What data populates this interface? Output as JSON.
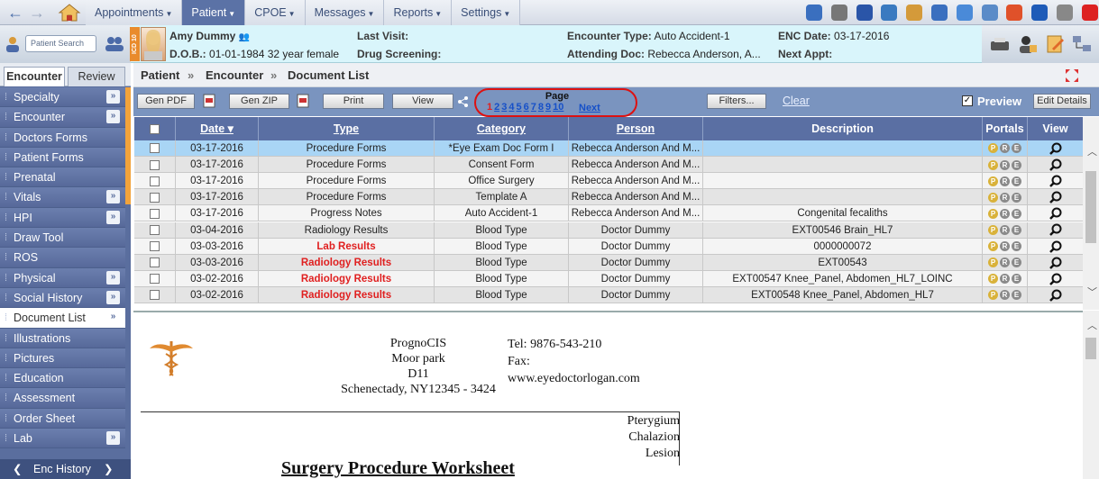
{
  "nav": {
    "back": "←",
    "forward": "→"
  },
  "menus": [
    {
      "label": "Appointments",
      "active": false
    },
    {
      "label": "Patient",
      "active": true
    },
    {
      "label": "CPOE",
      "active": false
    },
    {
      "label": "Messages",
      "active": false
    },
    {
      "label": "Reports",
      "active": false
    },
    {
      "label": "Settings",
      "active": false
    }
  ],
  "top_icons": [
    "calendar-icon",
    "gauge-icon",
    "bill-icon",
    "schedule-icon",
    "doctor-icon",
    "stethoscope-icon",
    "mail-icon",
    "documents-icon",
    "lifebuoy-icon",
    "info-icon",
    "checkbox-icon",
    "power-icon"
  ],
  "search": {
    "placeholder": "Patient Search"
  },
  "icd": "ICD 10",
  "patient": {
    "name": "Amy Dummy",
    "dob_label": "D.O.B.:",
    "dob_value": "01-01-1984 32 year female",
    "last_visit_label": "Last Visit:",
    "last_visit_value": "",
    "drug_label": "Drug Screening:",
    "drug_value": "",
    "enc_type_label": "Encounter Type:",
    "enc_type_value": "Auto Accident-1",
    "att_doc_label": "Attending Doc:",
    "att_doc_value": "Rebecca Anderson, A...",
    "enc_date_label": "ENC Date:",
    "enc_date_value": "03-17-2016",
    "next_appt_label": "Next Appt:",
    "next_appt_value": ""
  },
  "tabs": {
    "encounter": "Encounter",
    "review": "Review"
  },
  "sidebar": [
    {
      "label": "Specialty",
      "chev": true
    },
    {
      "label": "Encounter",
      "chev": true
    },
    {
      "label": "Doctors Forms",
      "chev": false
    },
    {
      "label": "Patient Forms",
      "chev": false
    },
    {
      "label": "Prenatal",
      "chev": false
    },
    {
      "label": "Vitals",
      "chev": true
    },
    {
      "label": "HPI",
      "chev": true
    },
    {
      "label": "Draw Tool",
      "chev": false
    },
    {
      "label": "ROS",
      "chev": false
    },
    {
      "label": "Physical",
      "chev": true
    },
    {
      "label": "Social History",
      "chev": true
    },
    {
      "label": "Document List",
      "chev": true,
      "active": true
    },
    {
      "label": "Illustrations",
      "chev": false
    },
    {
      "label": "Pictures",
      "chev": false
    },
    {
      "label": "Education",
      "chev": false
    },
    {
      "label": "Assessment",
      "chev": false
    },
    {
      "label": "Order Sheet",
      "chev": false
    },
    {
      "label": "Lab",
      "chev": true
    }
  ],
  "enc_history": "Enc History",
  "breadcrumb": {
    "patient": "Patient",
    "encounter": "Encounter",
    "current": "Document List",
    "sep": "»"
  },
  "toolbar": {
    "gen_pdf": "Gen PDF",
    "gen_zip": "Gen ZIP",
    "print": "Print",
    "view": "View",
    "page_label": "Page",
    "pages": [
      "1",
      "2",
      "3",
      "4",
      "5",
      "6",
      "7",
      "8",
      "9",
      "10"
    ],
    "current_page": "1",
    "next": "Next",
    "filters": "Filters...",
    "clear": "Clear",
    "preview": "Preview",
    "edit_details": "Edit Details"
  },
  "table": {
    "headers": {
      "date": "Date ▾",
      "type": "Type",
      "category": "Category",
      "person": "Person",
      "description": "Description",
      "portals": "Portals",
      "view": "View"
    },
    "rows": [
      {
        "date": "03-17-2016",
        "type": "Procedure Forms",
        "type_red": false,
        "category": "*Eye Exam Doc Form I",
        "person": "Rebecca Anderson And M...",
        "description": "",
        "selected": true
      },
      {
        "date": "03-17-2016",
        "type": "Procedure Forms",
        "type_red": false,
        "category": "Consent Form",
        "person": "Rebecca Anderson And M...",
        "description": ""
      },
      {
        "date": "03-17-2016",
        "type": "Procedure Forms",
        "type_red": false,
        "category": "Office Surgery",
        "person": "Rebecca Anderson And M...",
        "description": ""
      },
      {
        "date": "03-17-2016",
        "type": "Procedure Forms",
        "type_red": false,
        "category": "Template A",
        "person": "Rebecca Anderson And M...",
        "description": ""
      },
      {
        "date": "03-17-2016",
        "type": "Progress Notes",
        "type_red": false,
        "category": "Auto Accident-1",
        "person": "Rebecca Anderson And M...",
        "description": "Congenital fecaliths"
      },
      {
        "date": "03-04-2016",
        "type": "Radiology Results",
        "type_red": false,
        "category": "Blood Type",
        "person": "Doctor Dummy",
        "description": "EXT00546 Brain_HL7"
      },
      {
        "date": "03-03-2016",
        "type": "Lab Results",
        "type_red": true,
        "category": "Blood Type",
        "person": "Doctor Dummy",
        "description": "0000000072"
      },
      {
        "date": "03-03-2016",
        "type": "Radiology Results",
        "type_red": true,
        "category": "Blood Type",
        "person": "Doctor Dummy",
        "description": "EXT00543"
      },
      {
        "date": "03-02-2016",
        "type": "Radiology Results",
        "type_red": true,
        "category": "Blood Type",
        "person": "Doctor Dummy",
        "description": "EXT00547 Knee_Panel, Abdomen_HL7_LOINC"
      },
      {
        "date": "03-02-2016",
        "type": "Radiology Results",
        "type_red": true,
        "category": "Blood Type",
        "person": "Doctor Dummy",
        "description": "EXT00548 Knee_Panel, Abdomen_HL7"
      }
    ],
    "portal_badges": [
      "P",
      "R",
      "E"
    ]
  },
  "document": {
    "org": "PrognoCIS",
    "addr1": "Moor park",
    "addr2": "D11",
    "addr3": "Schenectady, NY12345 - 3424",
    "tel": "Tel: 9876-543-210",
    "fax": "Fax:",
    "web": "www.eyedoctorlogan.com",
    "conditions": [
      "Pterygium",
      "Chalazion",
      "Lesion"
    ],
    "title": "Surgery Procedure Worksheet"
  }
}
